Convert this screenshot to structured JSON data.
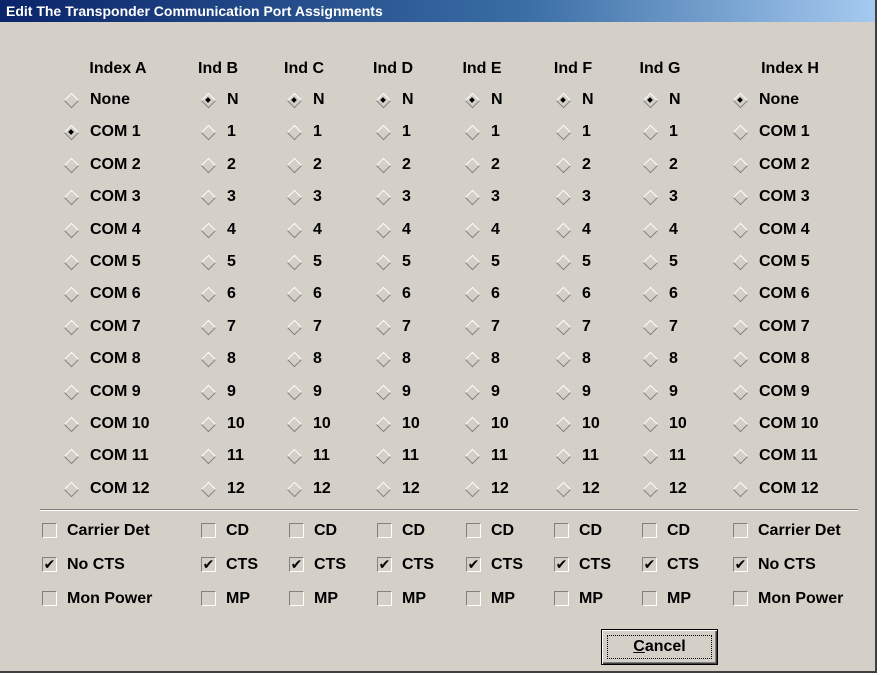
{
  "window": {
    "title": "Edit The Transponder Communication Port Assignments"
  },
  "columns": [
    {
      "header": "Index A",
      "options": [
        "None",
        "COM 1",
        "COM 2",
        "COM 3",
        "COM 4",
        "COM 5",
        "COM 6",
        "COM 7",
        "COM 8",
        "COM 9",
        "COM 10",
        "COM 11",
        "COM 12"
      ],
      "selected": 1,
      "checks": [
        {
          "label": "Carrier Det",
          "checked": false
        },
        {
          "label": "No CTS",
          "checked": true
        },
        {
          "label": "Mon Power",
          "checked": false
        }
      ]
    },
    {
      "header": "Ind B",
      "options": [
        "N",
        "1",
        "2",
        "3",
        "4",
        "5",
        "6",
        "7",
        "8",
        "9",
        "10",
        "11",
        "12"
      ],
      "selected": 0,
      "checks": [
        {
          "label": "CD",
          "checked": false
        },
        {
          "label": "CTS",
          "checked": true
        },
        {
          "label": "MP",
          "checked": false
        }
      ]
    },
    {
      "header": "Ind C",
      "options": [
        "N",
        "1",
        "2",
        "3",
        "4",
        "5",
        "6",
        "7",
        "8",
        "9",
        "10",
        "11",
        "12"
      ],
      "selected": 0,
      "checks": [
        {
          "label": "CD",
          "checked": false
        },
        {
          "label": "CTS",
          "checked": true
        },
        {
          "label": "MP",
          "checked": false
        }
      ]
    },
    {
      "header": "Ind D",
      "options": [
        "N",
        "1",
        "2",
        "3",
        "4",
        "5",
        "6",
        "7",
        "8",
        "9",
        "10",
        "11",
        "12"
      ],
      "selected": 0,
      "checks": [
        {
          "label": "CD",
          "checked": false
        },
        {
          "label": "CTS",
          "checked": true
        },
        {
          "label": "MP",
          "checked": false
        }
      ]
    },
    {
      "header": "Ind E",
      "options": [
        "N",
        "1",
        "2",
        "3",
        "4",
        "5",
        "6",
        "7",
        "8",
        "9",
        "10",
        "11",
        "12"
      ],
      "selected": 0,
      "checks": [
        {
          "label": "CD",
          "checked": false
        },
        {
          "label": "CTS",
          "checked": true
        },
        {
          "label": "MP",
          "checked": false
        }
      ]
    },
    {
      "header": "Ind F",
      "options": [
        "N",
        "1",
        "2",
        "3",
        "4",
        "5",
        "6",
        "7",
        "8",
        "9",
        "10",
        "11",
        "12"
      ],
      "selected": 0,
      "checks": [
        {
          "label": "CD",
          "checked": false
        },
        {
          "label": "CTS",
          "checked": true
        },
        {
          "label": "MP",
          "checked": false
        }
      ]
    },
    {
      "header": "Ind G",
      "options": [
        "N",
        "1",
        "2",
        "3",
        "4",
        "5",
        "6",
        "7",
        "8",
        "9",
        "10",
        "11",
        "12"
      ],
      "selected": 0,
      "checks": [
        {
          "label": "CD",
          "checked": false
        },
        {
          "label": "CTS",
          "checked": true
        },
        {
          "label": "MP",
          "checked": false
        }
      ]
    },
    {
      "header": "Index H",
      "options": [
        "None",
        "COM 1",
        "COM 2",
        "COM 3",
        "COM 4",
        "COM 5",
        "COM 6",
        "COM 7",
        "COM 8",
        "COM 9",
        "COM 10",
        "COM 11",
        "COM 12"
      ],
      "selected": 0,
      "checks": [
        {
          "label": "Carrier Det",
          "checked": false
        },
        {
          "label": "No CTS",
          "checked": true
        },
        {
          "label": "Mon Power",
          "checked": false
        }
      ]
    }
  ],
  "check_mark": "✔",
  "buttons": {
    "cancel_label": "Cancel"
  }
}
